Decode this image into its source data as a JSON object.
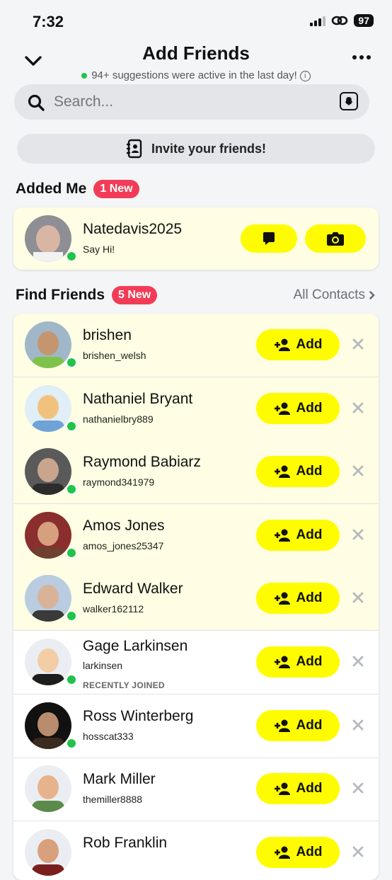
{
  "status": {
    "time": "7:32",
    "battery": "97"
  },
  "header": {
    "title": "Add Friends",
    "subtitle": "94+ suggestions were active in the last day!"
  },
  "search": {
    "placeholder": "Search..."
  },
  "invite": {
    "label": "Invite your friends!"
  },
  "added_me": {
    "title": "Added Me",
    "badge": "1 New",
    "items": [
      {
        "name": "Natedavis2025",
        "sub": "Say Hi!"
      }
    ]
  },
  "find_friends": {
    "title": "Find Friends",
    "badge": "5 New",
    "all_contacts": "All Contacts",
    "add_label": "Add",
    "items": [
      {
        "name": "brishen",
        "username": "brishen_welsh",
        "note": ""
      },
      {
        "name": "Nathaniel Bryant",
        "username": "nathanielbry889",
        "note": ""
      },
      {
        "name": "Raymond Babiarz",
        "username": "raymond341979",
        "note": ""
      },
      {
        "name": "Amos Jones",
        "username": "amos_jones25347",
        "note": ""
      },
      {
        "name": "Edward Walker",
        "username": "walker162112",
        "note": ""
      },
      {
        "name": "Gage Larkinsen",
        "username": "larkinsen",
        "note": "RECENTLY JOINED"
      },
      {
        "name": "Ross Winterberg",
        "username": "hosscat333",
        "note": ""
      },
      {
        "name": "Mark Miller",
        "username": "themiller8888",
        "note": ""
      },
      {
        "name": "Rob Franklin",
        "username": "",
        "note": ""
      }
    ]
  },
  "colors": {
    "accent": "#fffc00",
    "badge": "#f23c57",
    "online": "#1fc449",
    "highlight": "#fffde3"
  }
}
